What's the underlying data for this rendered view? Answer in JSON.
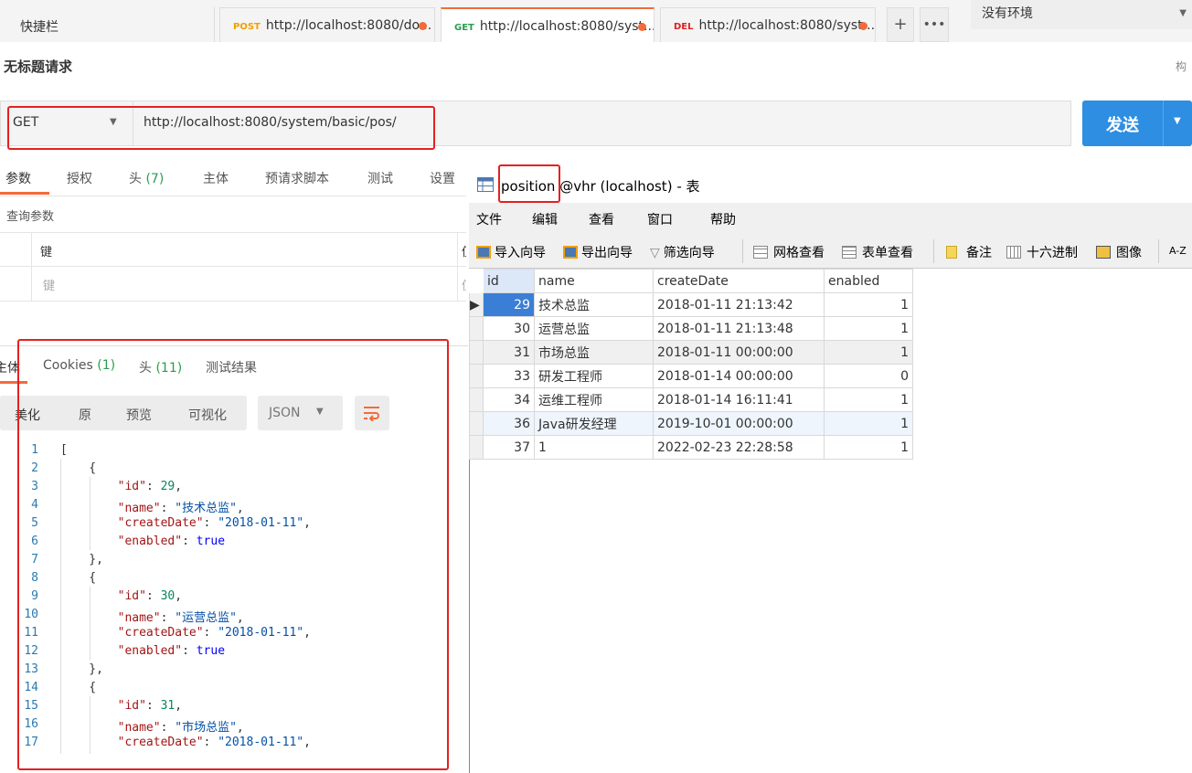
{
  "topbar": {
    "shortcut": "快捷栏",
    "tabs": [
      {
        "method": "POST",
        "url": "http://localhost:8080/do...",
        "color": "#f0a000"
      },
      {
        "method": "GET",
        "url": "http://localhost:8080/syst...",
        "color": "#2a9d4f"
      },
      {
        "method": "DEL",
        "url": "http://localhost:8080/syst...",
        "color": "#e02020"
      }
    ],
    "add_icon": "plus-icon",
    "more_icon": "more-icon",
    "environment": "没有环境"
  },
  "request": {
    "title": "无标题请求",
    "right_hint": "构",
    "method": "GET",
    "url": "http://localhost:8080/system/basic/pos/",
    "send_label": "发送"
  },
  "request_tabs": [
    "参数",
    "授权",
    "头",
    "(7)",
    "主体",
    "预请求脚本",
    "测试",
    "设置"
  ],
  "params": {
    "section_label": "查询参数",
    "key_header": "键",
    "value_header": "值",
    "key_placeholder": "键",
    "value_placeholder": "值"
  },
  "response_tabs": {
    "body": "主体",
    "cookies": "Cookies",
    "cookies_count": "(1)",
    "headers": "头",
    "headers_count": "(11)",
    "test_results": "测试结果"
  },
  "response_toolbar": {
    "pretty": "美化",
    "raw": "原",
    "preview": "预览",
    "visualize": "可视化",
    "format": "JSON"
  },
  "code_lines": [
    "[",
    "    {",
    "        \"id\": 29,",
    "        \"name\": \"技术总监\",",
    "        \"createDate\": \"2018-01-11\",",
    "        \"enabled\": true",
    "    },",
    "    {",
    "        \"id\": 30,",
    "        \"name\": \"运营总监\",",
    "        \"createDate\": \"2018-01-11\",",
    "        \"enabled\": true",
    "    },",
    "    {",
    "        \"id\": 31,",
    "        \"name\": \"市场总监\",",
    "        \"createDate\": \"2018-01-11\","
  ],
  "navicat": {
    "title_highlight": "position",
    "title_rest": " @vhr (localhost) - 表",
    "menu": [
      "文件",
      "编辑",
      "查看",
      "窗口",
      "帮助"
    ],
    "toolbar": [
      "导入向导",
      "导出向导",
      "筛选向导",
      "网格查看",
      "表单查看",
      "备注",
      "十六进制",
      "图像",
      "A-Z"
    ],
    "columns": [
      "id",
      "name",
      "createDate",
      "enabled"
    ],
    "rows": [
      [
        "29",
        "技术总监",
        "2018-01-11 21:13:42",
        "1"
      ],
      [
        "30",
        "运营总监",
        "2018-01-11 21:13:48",
        "1"
      ],
      [
        "31",
        "市场总监",
        "2018-01-11 00:00:00",
        "1"
      ],
      [
        "33",
        "研发工程师",
        "2018-01-14 00:00:00",
        "0"
      ],
      [
        "34",
        "运维工程师",
        "2018-01-14 16:11:41",
        "1"
      ],
      [
        "36",
        "Java研发经理",
        "2019-10-01 00:00:00",
        "1"
      ],
      [
        "37",
        "1",
        "2022-02-23 22:28:58",
        "1"
      ]
    ]
  },
  "colors": {
    "accent": "#f26b3a",
    "send": "#2d8ee2",
    "highlight_red": "#e52020",
    "selected_cell": "#3a7fd5"
  }
}
